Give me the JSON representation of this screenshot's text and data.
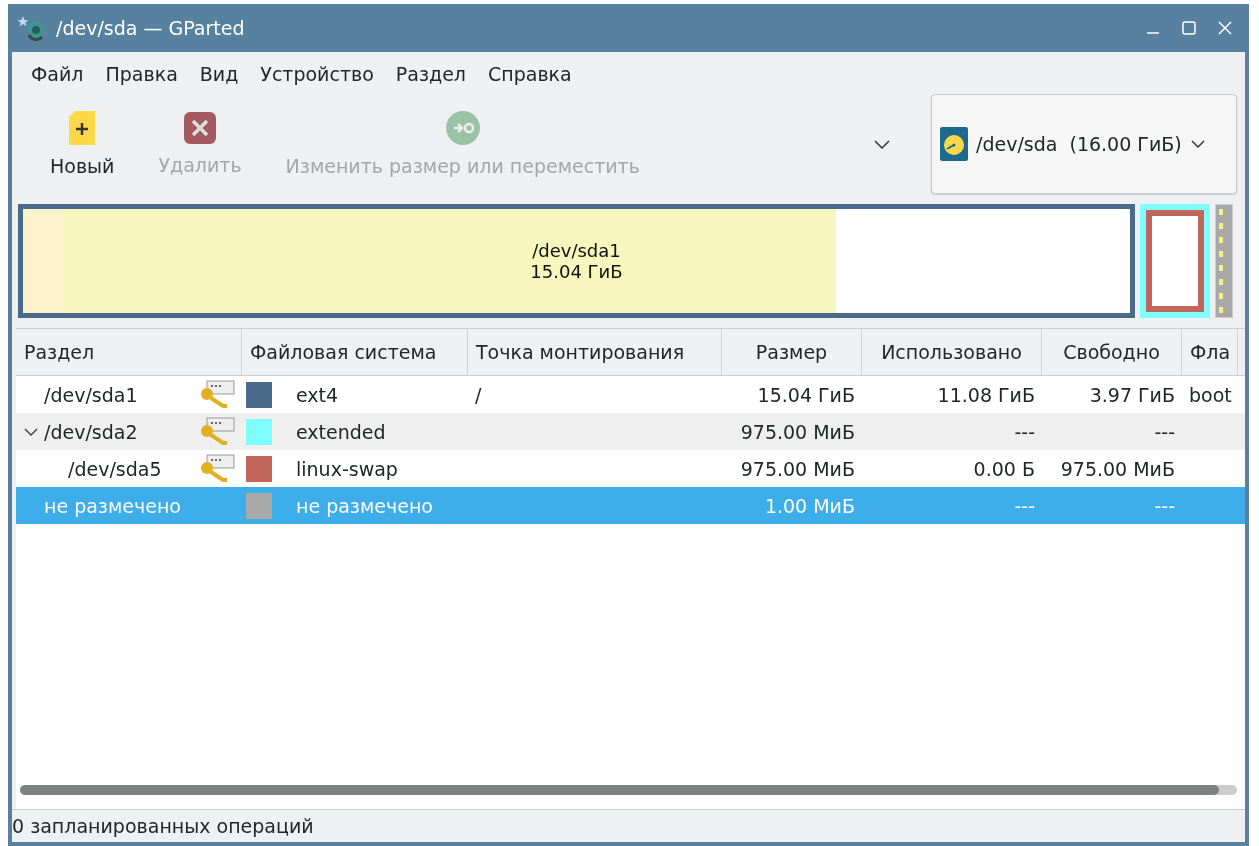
{
  "window": {
    "title": "/dev/sda — GParted"
  },
  "menu": [
    "Файл",
    "Правка",
    "Вид",
    "Устройство",
    "Раздел",
    "Справка"
  ],
  "toolbar": [
    {
      "kind": "new",
      "label": "Новый",
      "disabled": false
    },
    {
      "kind": "delete",
      "label": "Удалить",
      "disabled": true
    },
    {
      "kind": "resize",
      "label": "Изменить размер или переместить",
      "disabled": true
    }
  ],
  "device": {
    "name": "/dev/sda",
    "size": "(16.00 ГиБ)"
  },
  "disk_map": {
    "label": "/dev/sda1",
    "size": "15.04 ГиБ"
  },
  "table": {
    "columns": [
      "Раздел",
      "Файловая система",
      "Точка монтирования",
      "Размер",
      "Использовано",
      "Свободно",
      "Фла"
    ],
    "rows": [
      {
        "partition": "/dev/sda1",
        "busy": true,
        "color": "#4a6a89",
        "filesystem": "ext4",
        "mount": "/",
        "size": "15.04 ГиБ",
        "used": "11.08 ГиБ",
        "free": "3.97 ГиБ",
        "flags": "boot",
        "selected": false
      },
      {
        "partition": "/dev/sda2",
        "busy": true,
        "color": "#80ffff",
        "filesystem": "extended",
        "size": "975.00 МиБ",
        "used": "---",
        "free": "---",
        "selected": false,
        "expanded": true,
        "children": [
          {
            "partition": "/dev/sda5",
            "busy": true,
            "color": "#c0665a",
            "filesystem": "linux-swap",
            "size": "975.00 МиБ",
            "used": "0.00 Б",
            "free": "975.00 МиБ",
            "selected": false
          }
        ]
      },
      {
        "partition": "не размечено",
        "busy": false,
        "color": "#a8a8a8",
        "filesystem": "не размечено",
        "size": "1.00 МиБ",
        "used": "---",
        "free": "---",
        "selected": true
      }
    ]
  },
  "status_bar": "0 запланированных операций"
}
